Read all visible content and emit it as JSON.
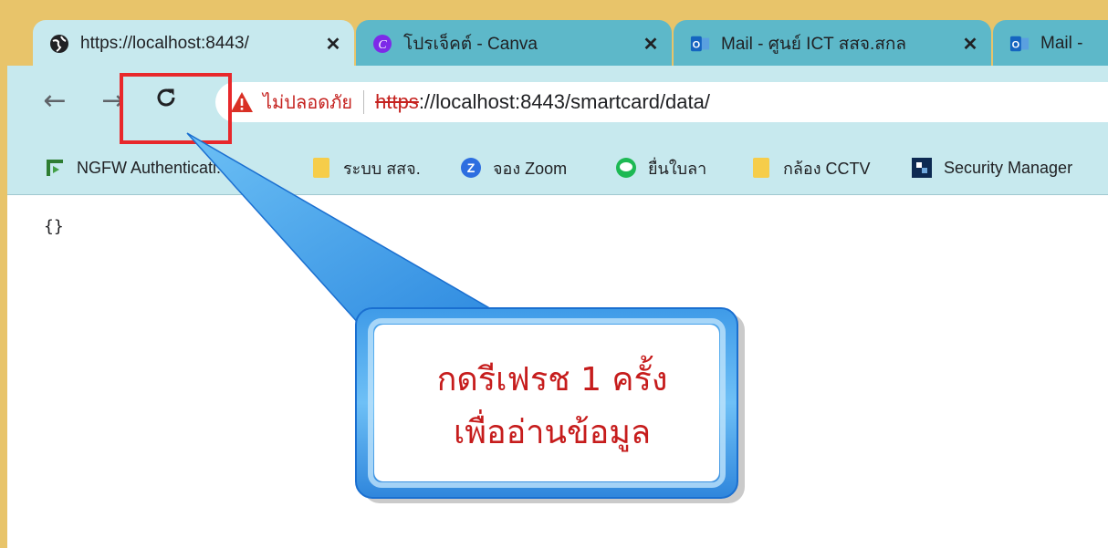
{
  "tabs": [
    {
      "title": "https://localhost:8443/",
      "favicon": "globe-icon",
      "active": true
    },
    {
      "title": "โปรเจ็คต์ - Canva",
      "favicon": "canva-icon",
      "active": false
    },
    {
      "title": "Mail - ศูนย์ ICT สสจ.สกล",
      "favicon": "outlook-icon",
      "active": false
    },
    {
      "title": "Mail -",
      "favicon": "outlook-icon",
      "active": false
    }
  ],
  "toolbar": {
    "security_warning": "ไม่ปลอดภัย",
    "url_scheme": "https",
    "url_rest": "://localhost:8443/smartcard/data/"
  },
  "bookmarks": [
    {
      "label": "NGFW Authenticati...",
      "icon": "fortinet-icon"
    },
    {
      "label": "ระบบ สสจ.",
      "icon": "folder-icon"
    },
    {
      "label": "จอง Zoom",
      "icon": "zoom-icon"
    },
    {
      "label": "ยื่นใบลา",
      "icon": "line-icon"
    },
    {
      "label": "กล้อง CCTV",
      "icon": "folder-icon"
    },
    {
      "label": "Security Manager",
      "icon": "security-manager-icon"
    }
  ],
  "page": {
    "body_text": "{}"
  },
  "callout": {
    "line1": "กดรีเฟรช 1 ครั้ง",
    "line2": "เพื่ออ่านข้อมูล"
  },
  "colors": {
    "frame": "#e8c46a",
    "active_tab": "#c7e9ee",
    "inactive_tab": "#5db8c9",
    "highlight": "#e8282b",
    "callout_text": "#c61c1c",
    "callout_fill": "#4aa8ec"
  }
}
